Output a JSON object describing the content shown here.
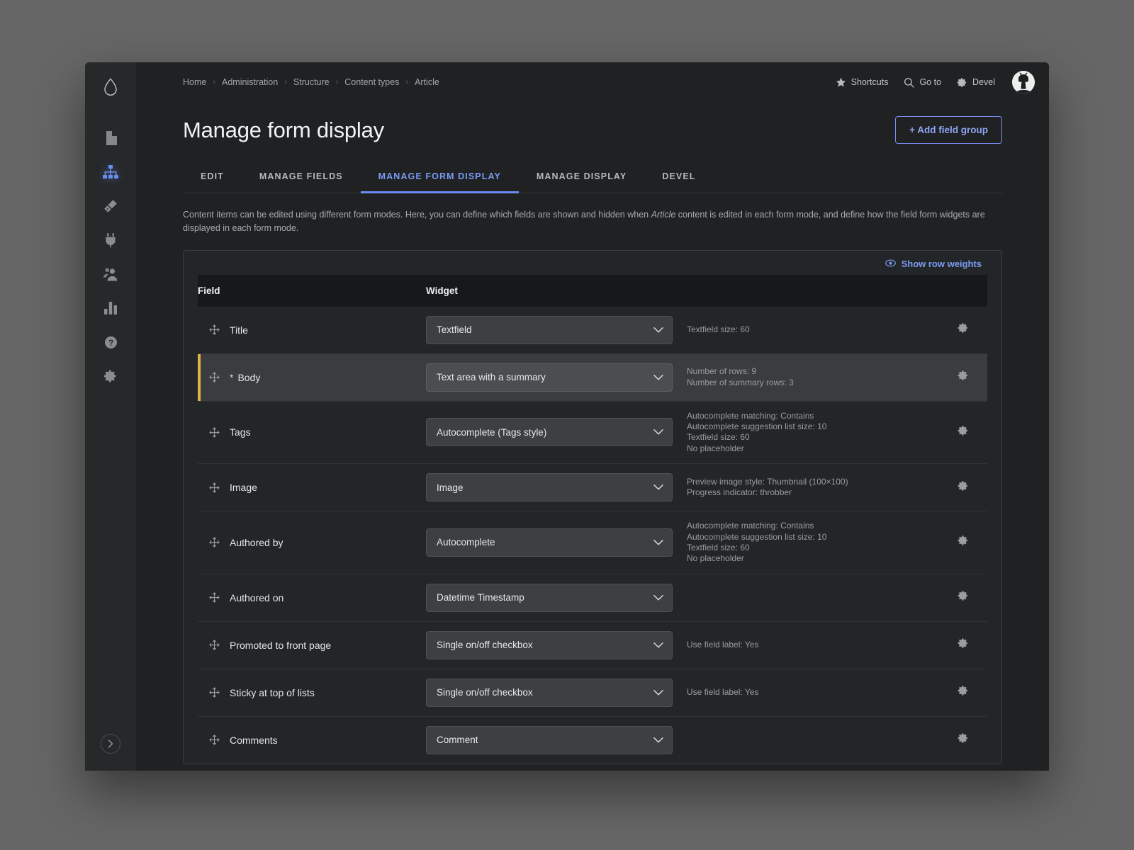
{
  "sidebar": {
    "logo_icon": "drupal-droplet-icon",
    "items": [
      {
        "icon": "content-file-icon",
        "name": "content",
        "active": false
      },
      {
        "icon": "structure-sitemap-icon",
        "name": "structure",
        "active": true
      },
      {
        "icon": "appearance-brush-icon",
        "name": "appearance",
        "active": false
      },
      {
        "icon": "extend-plug-icon",
        "name": "extend",
        "active": false
      },
      {
        "icon": "people-users-icon",
        "name": "people",
        "active": false
      },
      {
        "icon": "reports-bars-icon",
        "name": "reports",
        "active": false
      },
      {
        "icon": "help-question-icon",
        "name": "help",
        "active": false
      },
      {
        "icon": "configuration-gear-icon",
        "name": "configuration",
        "active": false
      }
    ],
    "expand_icon": "chevron-right-icon"
  },
  "breadcrumb": [
    {
      "label": "Home"
    },
    {
      "label": "Administration"
    },
    {
      "label": "Structure"
    },
    {
      "label": "Content types"
    },
    {
      "label": "Article"
    }
  ],
  "breadcrumb_separator": "›",
  "topbar": {
    "shortcuts_label": "Shortcuts",
    "shortcuts_icon": "star-icon",
    "goto_label": "Go to",
    "goto_icon": "search-icon",
    "devel_label": "Devel",
    "devel_icon": "gear-icon",
    "avatar_name": "user-avatar"
  },
  "header": {
    "title": "Manage form display",
    "add_field_group_label": "+ Add field group"
  },
  "tabs": [
    {
      "label": "EDIT",
      "active": false
    },
    {
      "label": "MANAGE FIELDS",
      "active": false
    },
    {
      "label": "MANAGE FORM DISPLAY",
      "active": true
    },
    {
      "label": "MANAGE DISPLAY",
      "active": false
    },
    {
      "label": "DEVEL",
      "active": false
    }
  ],
  "description": {
    "part1": "Content items can be edited using different form modes. Here, you can define which fields are shown and hidden when ",
    "emphasis": "Article",
    "part2": " content is edited in each form mode, and define how the field form widgets are displayed in each form mode."
  },
  "table": {
    "show_row_weights_label": "Show row weights",
    "show_row_weights_icon": "eye-icon",
    "columns": {
      "field": "Field",
      "widget": "Widget"
    },
    "rows": [
      {
        "field": "Title",
        "required": false,
        "widget": "Textfield",
        "summary": [
          "Textfield size: 60"
        ],
        "highlighted": false
      },
      {
        "field": "Body",
        "required": true,
        "required_marker": "*",
        "widget": "Text area with a summary",
        "summary": [
          "Number of rows: 9",
          "Number of summary rows: 3"
        ],
        "highlighted": true
      },
      {
        "field": "Tags",
        "required": false,
        "widget": "Autocomplete (Tags style)",
        "summary": [
          "Autocomplete matching: Contains",
          "Autocomplete suggestion list size: 10",
          "Textfield size: 60",
          "No placeholder"
        ],
        "highlighted": false
      },
      {
        "field": "Image",
        "required": false,
        "widget": "Image",
        "summary": [
          "Preview image style: Thumbnail (100×100)",
          "Progress indicator: throbber"
        ],
        "highlighted": false
      },
      {
        "field": "Authored by",
        "required": false,
        "widget": "Autocomplete",
        "summary": [
          "Autocomplete matching: Contains",
          "Autocomplete suggestion list size: 10",
          "Textfield size: 60",
          "No placeholder"
        ],
        "highlighted": false
      },
      {
        "field": "Authored on",
        "required": false,
        "widget": "Datetime Timestamp",
        "summary": [],
        "highlighted": false
      },
      {
        "field": "Promoted to front page",
        "required": false,
        "widget": "Single on/off checkbox",
        "summary": [
          "Use field label: Yes"
        ],
        "highlighted": false
      },
      {
        "field": "Sticky at top of lists",
        "required": false,
        "widget": "Single on/off checkbox",
        "summary": [
          "Use field label: Yes"
        ],
        "highlighted": false
      },
      {
        "field": "Comments",
        "required": false,
        "widget": "Comment",
        "summary": [],
        "highlighted": false
      }
    ],
    "row_settings_icon": "gear-icon",
    "drag_handle_icon": "move-arrows-icon"
  },
  "colors": {
    "accent": "#6a8ef0",
    "highlight_bar": "#e0b341",
    "page_bg": "#1f2123",
    "rail_bg": "#262829"
  }
}
